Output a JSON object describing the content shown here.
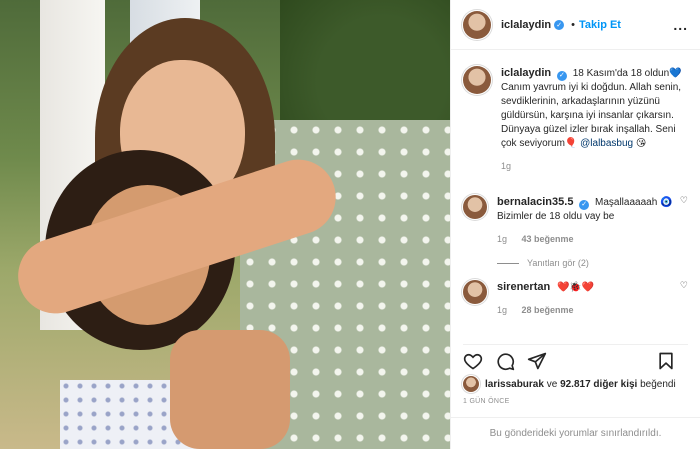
{
  "post": {
    "username": "iclalaydin",
    "follow_label": "Takip Et",
    "more_label": "...",
    "caption_parts": {
      "text": "18 Kasım'da 18 oldun💙 Canım yavrum iyi ki doğdun. Allah senin, sevdiklerinin, arkadaşlarının yüzünü güldürsün, karşına iyi insanlar çıkarsın. Dünyaya güzel izler bırak inşallah. Seni çok seviyorum🎈",
      "mention": "@lalbasbug",
      "emoji": "😘"
    },
    "caption_time": "1g"
  },
  "comments": [
    {
      "username": "bernalacin35.5",
      "text": "Maşallaaaaah 🧿 Bizimler de 18 oldu vay be",
      "time": "1g",
      "likes": "43 beğenme",
      "replies": "Yanıtları gör (2)"
    },
    {
      "username": "sirenertan",
      "text": "❤️🐞❤️",
      "time": "1g",
      "likes": "28 beğenme"
    }
  ],
  "likes_line": {
    "liker": "larissaburak",
    "connector": " ve ",
    "count": "92.817 diğer kişi",
    "suffix": " beğendi"
  },
  "timestamp": "1 GÜN ÖNCE",
  "comments_limited": "Bu gönderideki yorumlar sınırlandırıldı."
}
